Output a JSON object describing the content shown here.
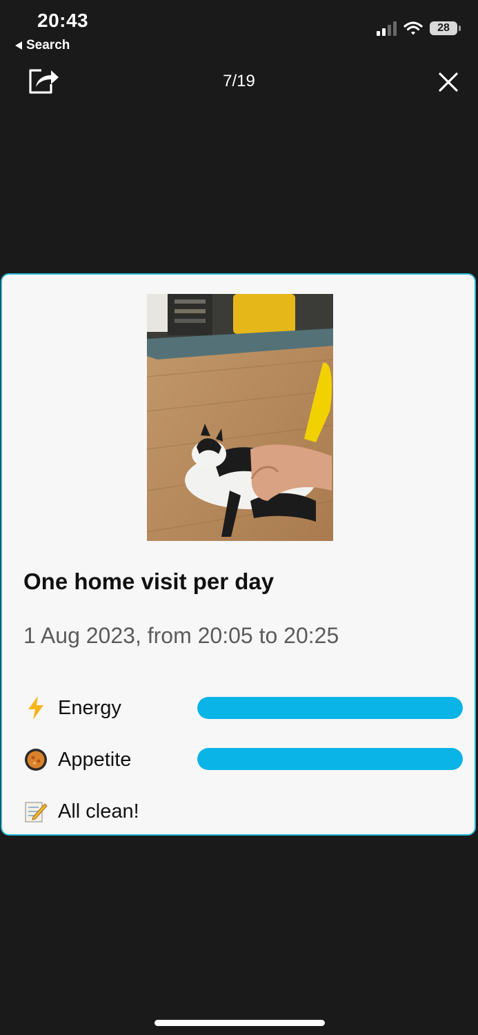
{
  "status_bar": {
    "time": "20:43",
    "back_label": "Search",
    "battery": "28"
  },
  "viewer": {
    "counter": "7/19"
  },
  "visit": {
    "title": "One home visit per day",
    "date": "1 Aug 2023, from 20:05 to 20:25",
    "metrics": [
      {
        "icon": "lightning-bolt-icon",
        "label": "Energy",
        "level": 1.0
      },
      {
        "icon": "food-bowl-icon",
        "label": "Appetite",
        "level": 1.0
      }
    ],
    "note": {
      "icon": "memo-pencil-icon",
      "label": "All clean!"
    }
  },
  "colors": {
    "accent": "#0ab4e6",
    "card_border": "#2ab7d6",
    "background": "#1a1a1b"
  }
}
